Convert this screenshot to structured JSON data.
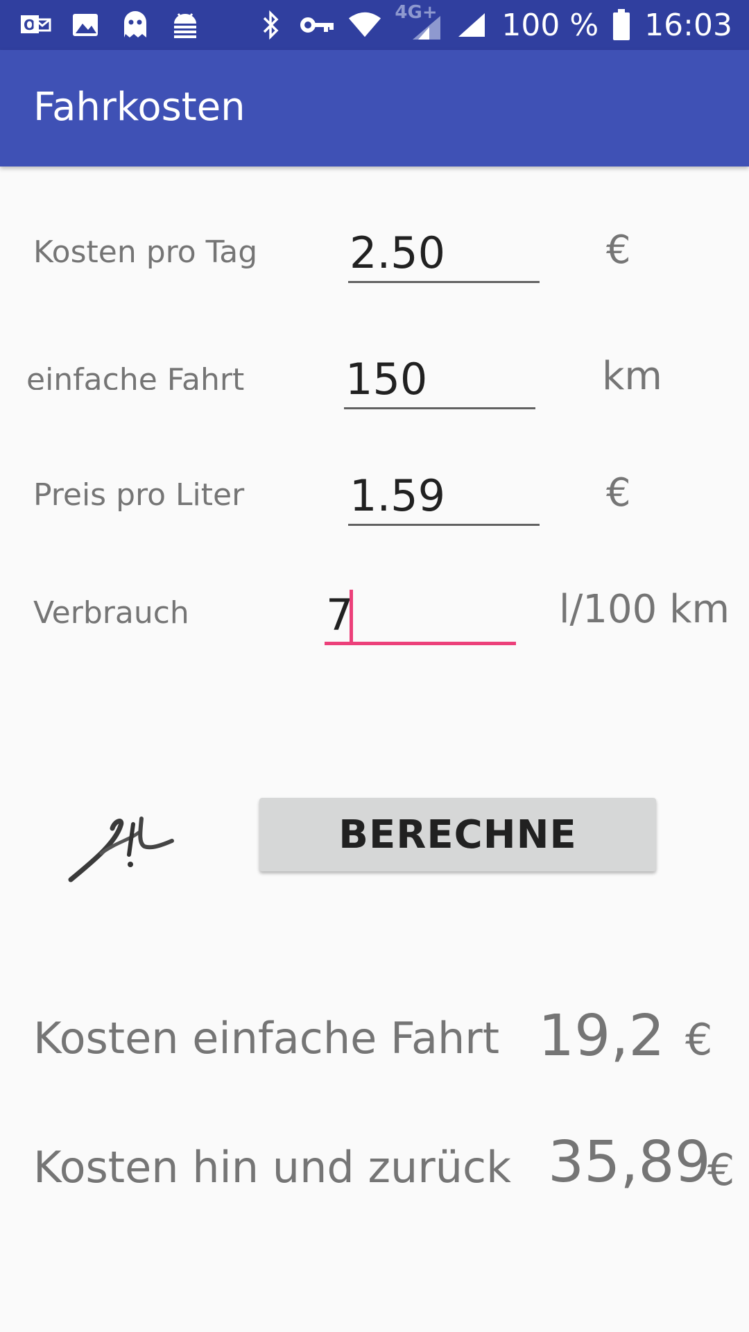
{
  "status_bar": {
    "left_icons": [
      "mail-icon",
      "image-icon",
      "ghost-icon",
      "android-debug-icon"
    ],
    "right_icons": [
      "bluetooth-icon",
      "key-icon",
      "wifi-icon",
      "signal-4g-icon",
      "signal-icon",
      "battery-icon"
    ],
    "network_label": "4G+",
    "battery": "100 %",
    "time": "16:03"
  },
  "app_bar": {
    "title": "Fahrkosten"
  },
  "form": {
    "rows": [
      {
        "label": "Kosten pro Tag",
        "value": "2.50",
        "unit": "€"
      },
      {
        "label": "einfache Fahrt",
        "value": "150",
        "unit": "km"
      },
      {
        "label": "Preis pro Liter",
        "value": "1.59",
        "unit": "€"
      },
      {
        "label": "Verbrauch",
        "value": "7",
        "unit": "l/100 km"
      }
    ]
  },
  "calculate_button": {
    "label": "BERECHNE"
  },
  "logo": {
    "icon": "signature-logo"
  },
  "results": {
    "one_way": {
      "label": "Kosten einfache Fahrt",
      "value": "19,2",
      "unit": "€"
    },
    "round_trip": {
      "label": "Kosten hin und zurück",
      "value": "35,89",
      "unit": "€"
    }
  },
  "colors": {
    "status_bar": "#303f9f",
    "app_bar": "#3f51b5",
    "accent": "#ec407a"
  }
}
